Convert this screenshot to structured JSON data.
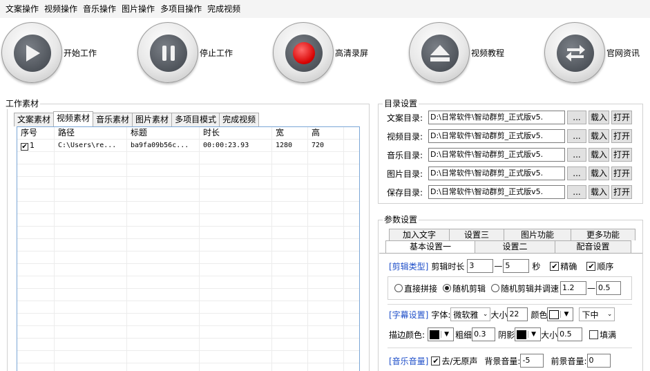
{
  "menu": [
    "文案操作",
    "视频操作",
    "音乐操作",
    "图片操作",
    "多项目操作",
    "完成视频"
  ],
  "toolbar": {
    "start": "开始工作",
    "stop": "停止工作",
    "record": "高清录屏",
    "tutorial": "视频教程",
    "news": "官网资讯"
  },
  "materials": {
    "title": "工作素材",
    "tabs": [
      "文案素材",
      "视频素材",
      "音乐素材",
      "图片素材",
      "多项目模式",
      "完成视频"
    ],
    "active_tab": "视频素材",
    "columns": [
      "序号",
      "路径",
      "标题",
      "时长",
      "宽",
      "高"
    ],
    "rows": [
      {
        "index": "1",
        "checked": true,
        "path": "C:\\Users\\re...",
        "title": "ba9fa09b56c...",
        "duration": "00:00:23.93",
        "width": "1280",
        "height": "720"
      }
    ]
  },
  "dirs": {
    "title": "目录设置",
    "browse": "...",
    "load": "载入",
    "open": "打开",
    "items": [
      {
        "label": "文案目录:",
        "value": "D:\\日常软件\\智动群剪_正式版v5."
      },
      {
        "label": "视频目录:",
        "value": "D:\\日常软件\\智动群剪_正式版v5."
      },
      {
        "label": "音乐目录:",
        "value": "D:\\日常软件\\智动群剪_正式版v5."
      },
      {
        "label": "图片目录:",
        "value": "D:\\日常软件\\智动群剪_正式版v5."
      },
      {
        "label": "保存目录:",
        "value": "D:\\日常软件\\智动群剪_正式版v5."
      }
    ]
  },
  "params": {
    "title": "参数设置",
    "tabs_row1": [
      "加入文字",
      "设置三",
      "图片功能",
      "更多功能"
    ],
    "tabs_row2": [
      "基本设置一",
      "设置二",
      "配音设置"
    ],
    "clip": {
      "tag": "[剪辑类型]",
      "duration_label": "剪辑时长",
      "min": "3",
      "dash": "—",
      "max": "5",
      "unit": "秒",
      "precise": "精确",
      "order": "顺序"
    },
    "modes": {
      "direct": "直接拼接",
      "random": "随机剪辑",
      "random_speed": "随机剪辑并调速",
      "speed_min": "1.2",
      "dash": "—",
      "speed_max": "0.5"
    },
    "subtitle": {
      "tag": "[字幕设置]",
      "font_label": "字体:",
      "font": "微软雅",
      "size_label": "大小",
      "size": "22",
      "color_label": "颜色",
      "position": "下中",
      "stroke_label": "描边颜色:",
      "thickness_label": "粗细",
      "thickness": "0.3",
      "shadow_label": "阴影",
      "shadow_size_label": "大小",
      "shadow_size": "0.5",
      "fill": "填满"
    },
    "audio": {
      "tag": "[音乐音量]",
      "remove_original": "去/无原声",
      "bg_label": "背景音量:",
      "bg": "-5",
      "fg_label": "前景音量:",
      "fg": "0"
    }
  }
}
